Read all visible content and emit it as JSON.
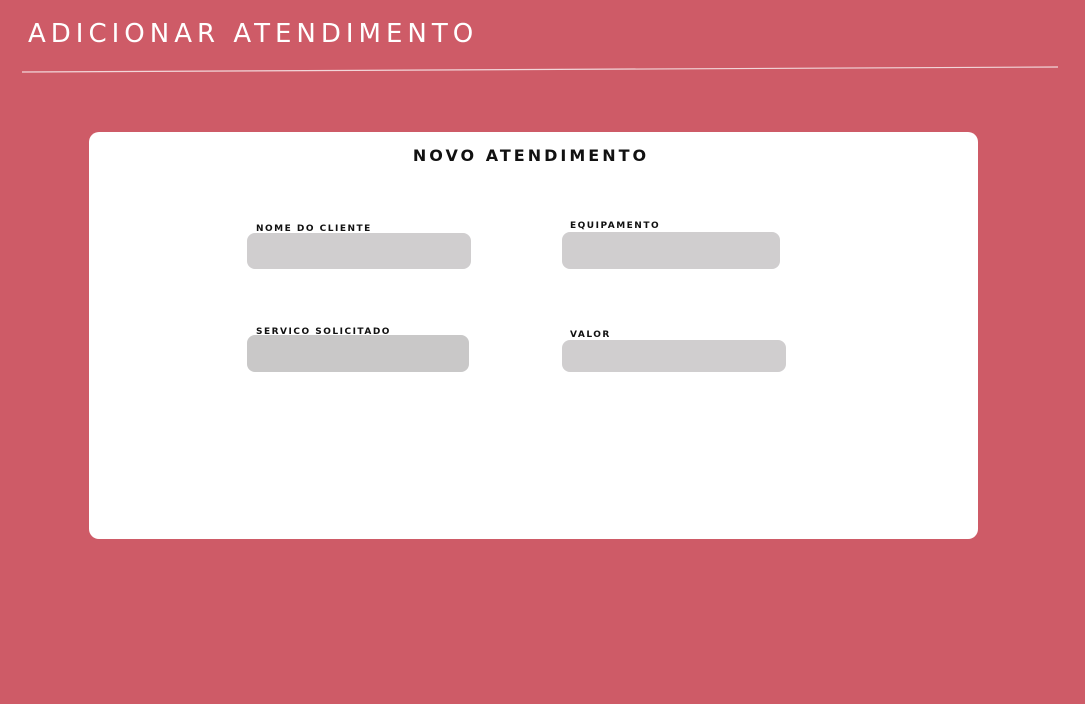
{
  "header": {
    "title": "ADICIONAR ATENDIMENTO"
  },
  "form": {
    "title": "NOVO ATENDIMENTO",
    "fields": [
      {
        "label": "NOME DO CLIENTE",
        "value": "",
        "placeholder": ""
      },
      {
        "label": "EQUIPAMENTO",
        "value": "",
        "placeholder": ""
      },
      {
        "label": "SERVICO SOLICITADO",
        "value": "",
        "placeholder": ""
      },
      {
        "label": "VALOR",
        "value": "",
        "placeholder": ""
      }
    ]
  },
  "colors": {
    "background": "#ce5b67",
    "card": "#ffffff",
    "input": "#d0cecf",
    "divider": "#f2d6d9"
  }
}
